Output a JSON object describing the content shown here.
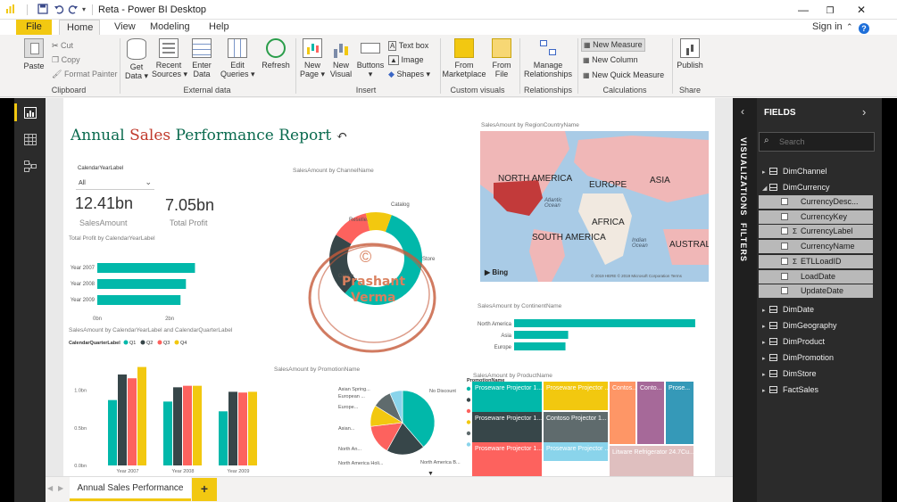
{
  "titlebar": {
    "title": "Reta - Power BI Desktop",
    "undo_icon": "undo-icon",
    "redo_icon": "redo-icon"
  },
  "menu": {
    "file": "File",
    "tabs": [
      "Home",
      "View",
      "Modeling",
      "Help"
    ],
    "sign_in": "Sign in"
  },
  "ribbon": {
    "clipboard": {
      "paste": "Paste",
      "cut": "Cut",
      "copy": "Copy",
      "format_painter": "Format Painter",
      "label": "Clipboard"
    },
    "external": {
      "get_data": "Get\nData ▾",
      "recent": "Recent\nSources ▾",
      "enter": "Enter\nData",
      "edit": "Edit\nQueries ▾",
      "refresh": "Refresh",
      "label": "External data"
    },
    "insert": {
      "new_page": "New\nPage ▾",
      "new_visual": "New\nVisual",
      "buttons": "Buttons\n▾",
      "text_box": "Text box",
      "image": "Image",
      "shapes": "Shapes ▾",
      "label": "Insert"
    },
    "custom": {
      "marketplace": "From\nMarketplace",
      "file": "From\nFile",
      "label": "Custom visuals"
    },
    "relationships": {
      "manage": "Manage\nRelationships",
      "label": "Relationships"
    },
    "calculations": {
      "new_measure": "New Measure",
      "new_column": "New Column",
      "new_quick": "New Quick Measure",
      "label": "Calculations"
    },
    "share": {
      "publish": "Publish",
      "label": "Share"
    }
  },
  "report": {
    "title_part1": "Annual ",
    "title_part2": "Sales",
    "title_part3": " Performance Report",
    "slicer_label": "CalendarYearLabel",
    "slicer_value": "All",
    "kpi1_value": "12.41bn",
    "kpi1_label": "SalesAmount",
    "kpi2_value": "7.05bn",
    "kpi2_label": "Total Profit",
    "watermark_line1": "Prashant",
    "watermark_line2": "Verma",
    "watermark_symbol": "©"
  },
  "chart_data": [
    {
      "type": "bar",
      "title": "Total Profit by CalendarYearLabel",
      "orientation": "horizontal",
      "categories": [
        "Year 2007",
        "Year 2008",
        "Year 2009"
      ],
      "values": [
        2.7,
        2.45,
        2.3
      ],
      "x_ticks": [
        "0bn",
        "2bn"
      ],
      "xlim": [
        0,
        3.7
      ],
      "color": "#01b8aa"
    },
    {
      "type": "pie",
      "title": "SalesAmount by ChannelName",
      "donut": true,
      "labels": [
        "Store",
        "Online",
        "Reseller",
        "Catalog"
      ],
      "values": [
        56,
        22,
        13,
        9
      ],
      "colors": [
        "#01b8aa",
        "#374649",
        "#fd625e",
        "#f2c80f"
      ]
    },
    {
      "type": "bar",
      "title": "SalesAmount by RegionCountryName",
      "subtype": "map",
      "map_labels": [
        "NORTH AMERICA",
        "EUROPE",
        "ASIA",
        "AFRICA",
        "SOUTH AMERICA",
        "AUSTRAL",
        "Atlantic Ocean",
        "Indian Ocean"
      ],
      "credits": "Bing",
      "copyright": "© 2019 HERE © 2019 Microsoft Corporation  Terms"
    },
    {
      "type": "bar",
      "title": "SalesAmount by ContinentName",
      "orientation": "horizontal",
      "categories": [
        "North America",
        "Asia",
        "Europe"
      ],
      "values": [
        6.7,
        2.0,
        1.9
      ],
      "xlim": [
        0,
        7
      ],
      "color": "#01b8aa"
    },
    {
      "type": "bar",
      "title": "SalesAmount by CalendarYearLabel and CalendarQuarterLabel",
      "legend_title": "CalendarQuarterLabel",
      "categories": [
        "Year 2007",
        "Year 2008",
        "Year 2009"
      ],
      "y_ticks": [
        "1.0bn",
        "0.5bn",
        "0.0bn"
      ],
      "ylim": [
        0,
        1.4
      ],
      "series": [
        {
          "name": "Q1",
          "values": [
            0.87,
            0.85,
            0.72
          ],
          "color": "#01b8aa"
        },
        {
          "name": "Q2",
          "values": [
            1.21,
            1.04,
            0.98
          ],
          "color": "#374649"
        },
        {
          "name": "Q3",
          "values": [
            1.16,
            1.06,
            0.97
          ],
          "color": "#fd625e"
        },
        {
          "name": "Q4",
          "values": [
            1.31,
            1.06,
            0.98
          ],
          "color": "#f2c80f"
        }
      ]
    },
    {
      "type": "pie",
      "title": "SalesAmount by PromotionName",
      "legend_title": "PromotionName",
      "labels": [
        "No Discount",
        "North America B...",
        "North America ...",
        "North America S...",
        "Asian Holiday Pr...",
        "European Holida..."
      ],
      "values": [
        36,
        18,
        14,
        10,
        9,
        6
      ],
      "colors": [
        "#01b8aa",
        "#374649",
        "#fd625e",
        "#f2c80f",
        "#5f6b6d",
        "#8ad4eb"
      ],
      "slice_labels": [
        "No Discount",
        "North America B...",
        "North America Holi...",
        "North An...",
        "Asian...",
        "Europe...",
        "European ...",
        "Asian Spring..."
      ]
    },
    {
      "type": "heatmap",
      "title": "SalesAmount by ProductName",
      "subtype": "treemap",
      "tiles": [
        {
          "label": "Proseware Projector 1...",
          "color": "#01b8aa"
        },
        {
          "label": "Proseware Projector 1...",
          "color": "#374649"
        },
        {
          "label": "Proseware Projector 1...",
          "color": "#fd625e"
        },
        {
          "label": "Proseware Projector ...",
          "color": "#f2c80f"
        },
        {
          "label": "Contoso Projector 1...",
          "color": "#5f6b6d"
        },
        {
          "label": "Proseware Projector ...",
          "color": "#8ad4eb"
        },
        {
          "label": "Contos...",
          "color": "#fe9666"
        },
        {
          "label": "Conto...",
          "color": "#a66999"
        },
        {
          "label": "Prose...",
          "color": "#3599b8"
        },
        {
          "label": "Litware Refrigerator 24.7Cu...",
          "color": "#dfbfbf"
        }
      ]
    }
  ],
  "tabs": {
    "page": "Annual Sales Performance",
    "add": "+"
  },
  "panes": {
    "visualizations": "VISUALIZATIONS",
    "filters": "FILTERS",
    "fields_title": "FIELDS",
    "search_placeholder": "Search",
    "tables_top": [
      "DimChannel",
      "DimCurrency"
    ],
    "currency_fields": [
      {
        "name": "CurrencyDesc...",
        "sigma": false
      },
      {
        "name": "CurrencyKey",
        "sigma": false
      },
      {
        "name": "CurrencyLabel",
        "sigma": true
      },
      {
        "name": "CurrencyName",
        "sigma": false
      },
      {
        "name": "ETLLoadID",
        "sigma": true
      },
      {
        "name": "LoadDate",
        "sigma": false
      },
      {
        "name": "UpdateDate",
        "sigma": false
      }
    ],
    "tables_bottom": [
      "DimDate",
      "DimGeography",
      "DimProduct",
      "DimPromotion",
      "DimStore",
      "FactSales"
    ]
  },
  "colors": {
    "accent": "#f2c811",
    "teal": "#01b8aa",
    "title_green": "#0b6b4f",
    "title_red": "#c0392b",
    "dark_pane": "#2b2b2b"
  }
}
